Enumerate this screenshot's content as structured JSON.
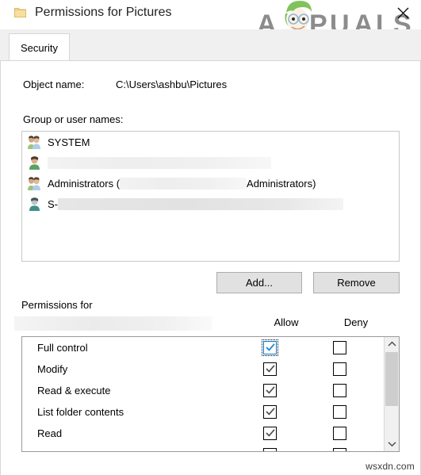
{
  "window": {
    "title": "Permissions for Pictures",
    "folder_icon": "folder-icon",
    "close_icon": "close-icon"
  },
  "watermark": {
    "brand": "APPUALS",
    "site": "wsxdn.com"
  },
  "tabs": [
    {
      "label": "Security",
      "active": true
    }
  ],
  "object": {
    "label": "Object name:",
    "value": "C:\\Users\\ashbu\\Pictures"
  },
  "groups": {
    "label": "Group or user names:",
    "items": [
      {
        "text": "SYSTEM",
        "icon": "group-users-icon",
        "redacted": false,
        "redacted_width": 0,
        "selected": false
      },
      {
        "text": "",
        "icon": "single-user-icon",
        "redacted": true,
        "redacted_width": 282,
        "selected": false
      },
      {
        "text": "Administrators (",
        "suffix": "Administrators)",
        "icon": "group-users-icon",
        "redacted": true,
        "redacted_width": 160,
        "selected": false
      },
      {
        "text": "S-",
        "icon": "single-user-icon",
        "redacted": true,
        "redacted_width": 360,
        "selected": true
      }
    ]
  },
  "buttons": {
    "add": "Add...",
    "remove": "Remove"
  },
  "permissions": {
    "label": "Permissions for",
    "principal_redacted": true,
    "columns": {
      "allow": "Allow",
      "deny": "Deny"
    },
    "rows": [
      {
        "name": "Full control",
        "allow": true,
        "deny": false,
        "focused": true
      },
      {
        "name": "Modify",
        "allow": true,
        "deny": false,
        "focused": false
      },
      {
        "name": "Read & execute",
        "allow": true,
        "deny": false,
        "focused": false
      },
      {
        "name": "List folder contents",
        "allow": true,
        "deny": false,
        "focused": false
      },
      {
        "name": "Read",
        "allow": true,
        "deny": false,
        "focused": false
      },
      {
        "name": "",
        "allow": false,
        "deny": false,
        "focused": false
      }
    ],
    "scroll": {
      "up_icon": "chevron-up-icon",
      "down_icon": "chevron-down-icon",
      "thumb_position": "near-top"
    }
  },
  "colors": {
    "accent": "#0078d7",
    "dialog_bg": "#ffffff",
    "tabstrip_bg": "#f0f0f0",
    "button_face": "#e1e1e1",
    "border": "#c8c8c8",
    "logo_gray": "#8c8c8c",
    "logo_green": "#7fc35c",
    "folder_yellow": "#f2d06b"
  }
}
